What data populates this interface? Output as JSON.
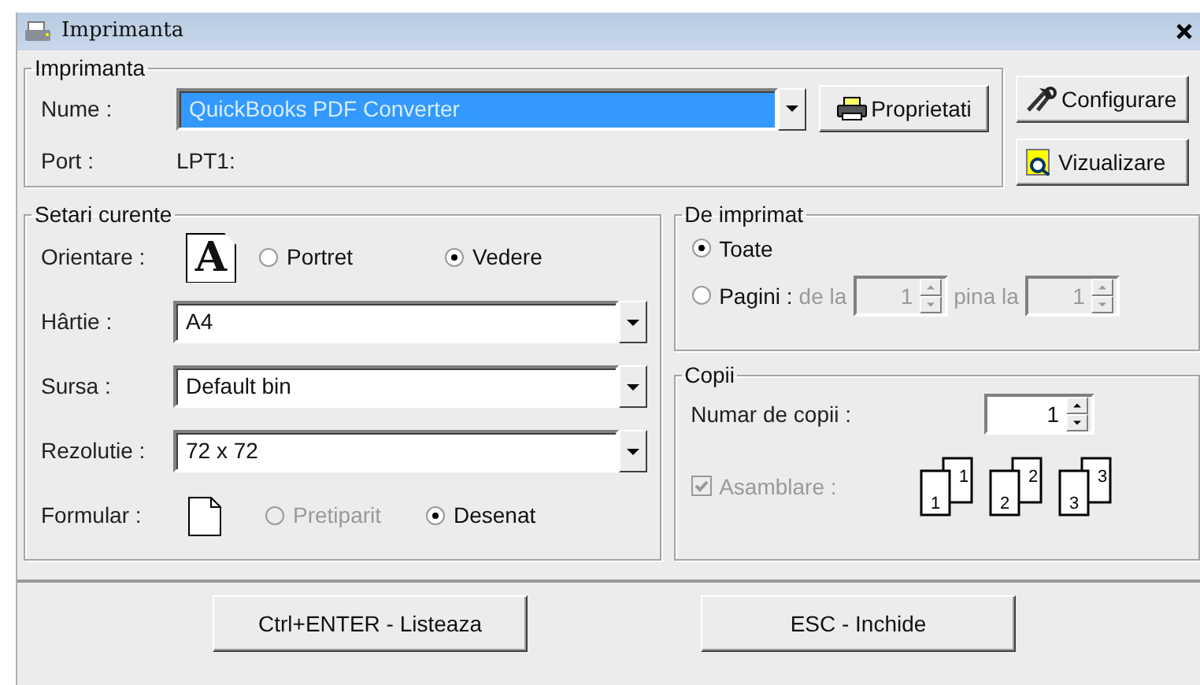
{
  "window": {
    "title": "Imprimanta"
  },
  "printer": {
    "legend": "Imprimanta",
    "name_label": "Nume :",
    "name_value": "QuickBooks PDF Converter",
    "name_selected": true,
    "port_label": "Port :",
    "port_value": "LPT1:",
    "properties_button": "Proprietati"
  },
  "side_buttons": [
    {
      "label": "Configurare",
      "kind": "configure"
    },
    {
      "label": "Vizualizare",
      "kind": "preview"
    }
  ],
  "settings": {
    "legend": "Setari curente",
    "orientation": {
      "label": "Orientare :",
      "icon_letter": "A",
      "options": [
        {
          "label": "Portret",
          "selected": false,
          "disabled": false
        },
        {
          "label": "Vedere",
          "selected": true,
          "disabled": false
        }
      ]
    },
    "selects": [
      {
        "label": "Hârtie :",
        "value": "A4"
      },
      {
        "label": "Sursa :",
        "value": "Default bin"
      },
      {
        "label": "Rezolutie :",
        "value": "72 x 72"
      }
    ],
    "form": {
      "label": "Formular :",
      "options": [
        {
          "label": "Pretiparit",
          "selected": false,
          "disabled": true
        },
        {
          "label": "Desenat",
          "selected": true,
          "disabled": false
        }
      ]
    }
  },
  "print_range": {
    "legend": "De imprimat",
    "options": [
      {
        "label": "Toate",
        "selected": true
      },
      {
        "label": "Pagini :",
        "selected": false
      }
    ],
    "from_label": "de la",
    "from_value": "1",
    "to_label": "pina la",
    "to_value": "1",
    "disabled": true
  },
  "copies": {
    "legend": "Copii",
    "count_label": "Numar de copii :",
    "count_value": "1",
    "collate": {
      "label": "Asamblare :",
      "checked": true,
      "disabled": true
    },
    "collate_sets": [
      {
        "front": "1",
        "back": "1"
      },
      {
        "front": "2",
        "back": "2"
      },
      {
        "front": "3",
        "back": "3"
      }
    ]
  },
  "footer_buttons": [
    "Ctrl+ENTER - Listeaza",
    "ESC - Inchide"
  ]
}
